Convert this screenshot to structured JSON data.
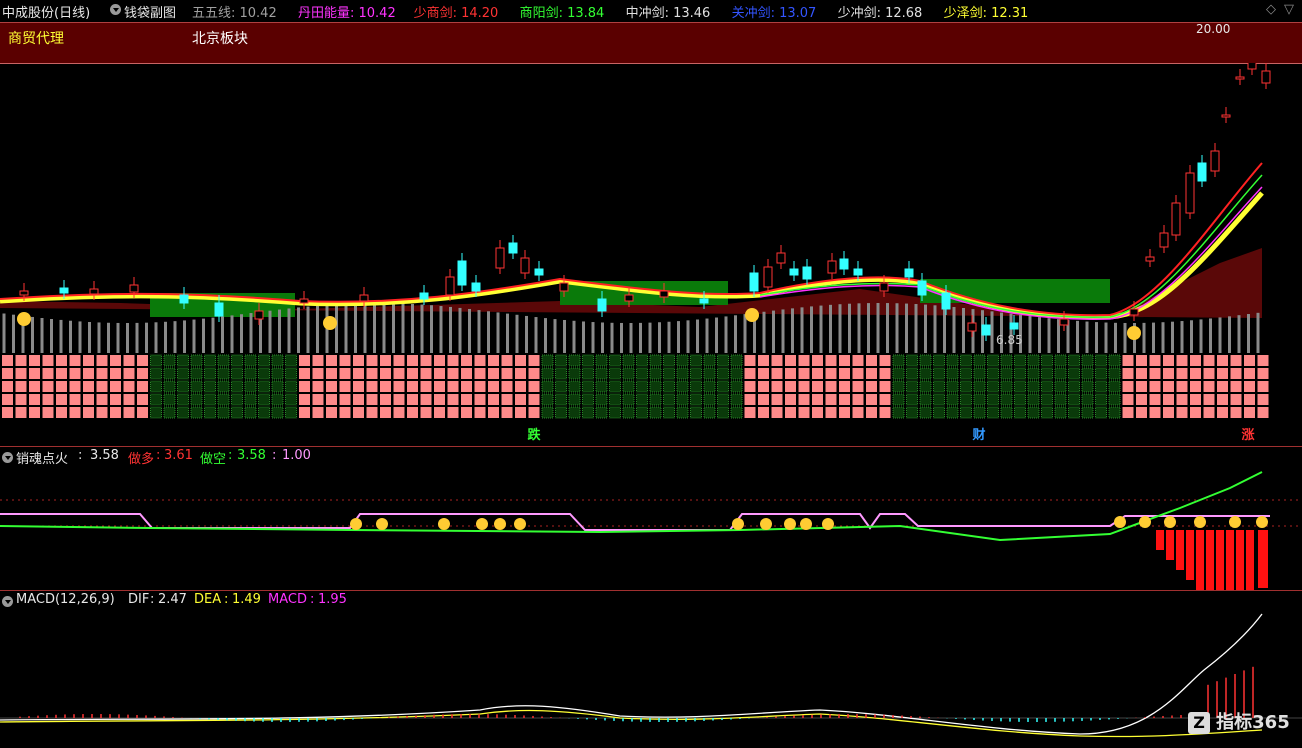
{
  "header": {
    "stock_title": "中成股份(日线)",
    "indicator_name": "钱袋副图",
    "ma_lines": [
      {
        "name": "五五线",
        "value": "10.42",
        "color": "#a0a0a0"
      },
      {
        "name": "丹田能量",
        "value": "10.42",
        "color": "#ff33ff"
      },
      {
        "name": "少商剑",
        "value": "14.20",
        "color": "#ff3333"
      },
      {
        "name": "商阳剑",
        "value": "13.84",
        "color": "#33ff33"
      },
      {
        "name": "中冲剑",
        "value": "13.46",
        "color": "#e0e0e0"
      },
      {
        "name": "关冲剑",
        "value": "13.07",
        "color": "#3355ff"
      },
      {
        "name": "少冲剑",
        "value": "12.68",
        "color": "#e0e0e0"
      },
      {
        "name": "少泽剑",
        "value": "12.31",
        "color": "#ffff33"
      }
    ]
  },
  "sector_band": {
    "industry": "商贸代理",
    "region": "北京板块"
  },
  "main_chart": {
    "high_label": "20.00",
    "low_label": "6.85",
    "markers": [
      {
        "text": "跌",
        "color": "#33ff33"
      },
      {
        "text": "财",
        "color": "#3399ff"
      },
      {
        "text": "涨",
        "color": "#ff3333"
      }
    ]
  },
  "panel2": {
    "name": "销魂点火",
    "name_value": "3.58",
    "do_long_label": "做多",
    "do_long_value": "3.61",
    "do_short_label": "做空",
    "do_short_value": "3.58",
    "extra_value": "1.00"
  },
  "panel3": {
    "name": "MACD(12,26,9)",
    "dif_label": "DIF",
    "dif_value": "2.47",
    "dea_label": "DEA",
    "dea_value": "1.49",
    "macd_label": "MACD",
    "macd_value": "1.95"
  },
  "watermark": {
    "text": "指标365"
  },
  "colors": {
    "up": "#ff3333",
    "down": "#33ffff",
    "band": "#5a0000",
    "grid": "#a03030"
  }
}
